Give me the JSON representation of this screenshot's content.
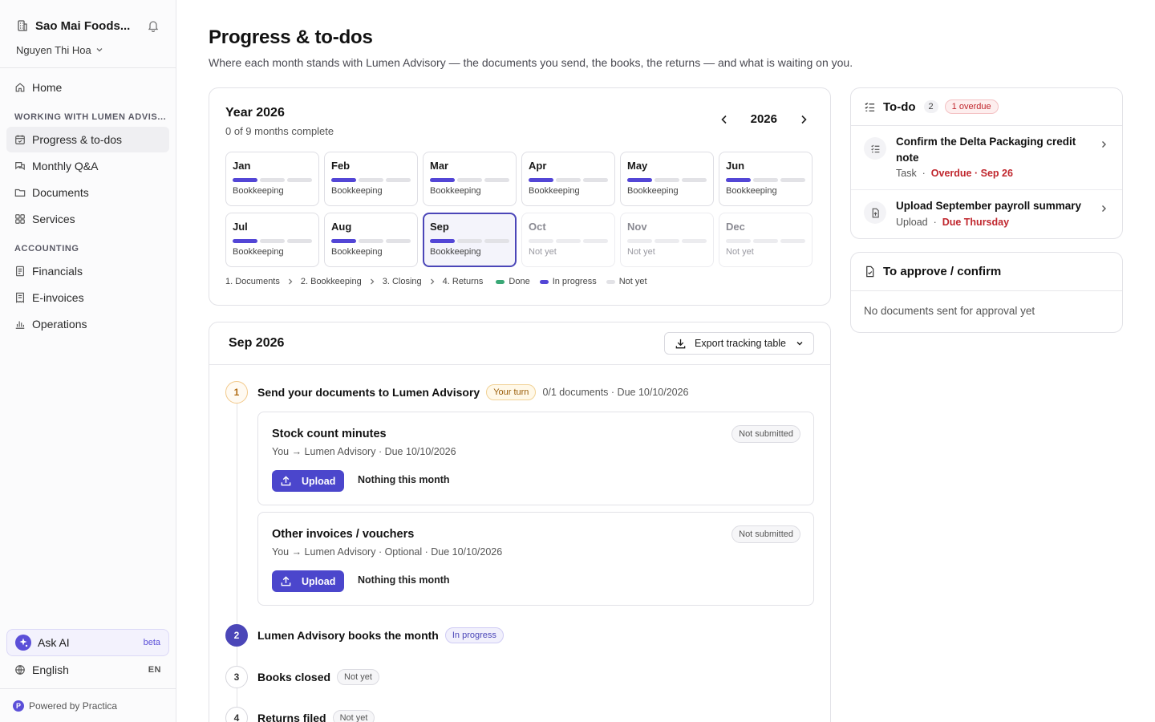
{
  "sidebar": {
    "org_name": "Sao Mai Foods...",
    "user_name": "Nguyen Thi Hoa",
    "home": "Home",
    "section_working": "WORKING WITH LUMEN ADVIS...",
    "items_working": [
      "Progress & to-dos",
      "Monthly Q&A",
      "Documents",
      "Services"
    ],
    "section_accounting": "ACCOUNTING",
    "items_accounting": [
      "Financials",
      "E-invoices",
      "Operations"
    ],
    "ask_ai": "Ask AI",
    "ask_ai_badge": "beta",
    "language": "English",
    "language_code": "EN",
    "powered_by": "Powered by Practica",
    "accent_color": "#5b4fd8"
  },
  "page": {
    "title": "Progress & to-dos",
    "subtitle": "Where each month stands with Lumen Advisory — the documents you send, the books, the returns — and what is waiting on you."
  },
  "year_card": {
    "title": "Year 2026",
    "subtitle": "0 of 9 months complete",
    "year": "2026",
    "months": [
      {
        "name": "Jan",
        "status": "Bookkeeping"
      },
      {
        "name": "Feb",
        "status": "Bookkeeping"
      },
      {
        "name": "Mar",
        "status": "Bookkeeping"
      },
      {
        "name": "Apr",
        "status": "Bookkeeping"
      },
      {
        "name": "May",
        "status": "Bookkeeping"
      },
      {
        "name": "Jun",
        "status": "Bookkeeping"
      },
      {
        "name": "Jul",
        "status": "Bookkeeping"
      },
      {
        "name": "Aug",
        "status": "Bookkeeping"
      },
      {
        "name": "Sep",
        "status": "Bookkeeping"
      },
      {
        "name": "Oct",
        "status": "Not yet"
      },
      {
        "name": "Nov",
        "status": "Not yet"
      },
      {
        "name": "Dec",
        "status": "Not yet"
      }
    ],
    "legend": {
      "stages": [
        "1. Documents",
        "2. Bookkeeping",
        "3. Closing",
        "4. Returns"
      ],
      "done": "Done",
      "in_progress": "In progress",
      "not_yet": "Not yet",
      "done_color": "#3aa876",
      "progress_color": "#5346d6",
      "not_yet_color": "#e2e2e6"
    }
  },
  "month_detail": {
    "title": "Sep 2026",
    "export_label": "Export tracking table",
    "steps": [
      {
        "num": "1",
        "title": "Send your documents to Lumen Advisory",
        "badge": "Your turn",
        "meta": "0/1 documents · Due 10/10/2026"
      },
      {
        "num": "2",
        "title": "Lumen Advisory books the month",
        "badge": "In progress"
      },
      {
        "num": "3",
        "title": "Books closed",
        "badge": "Not yet"
      },
      {
        "num": "4",
        "title": "Returns filed",
        "badge": "Not yet"
      }
    ],
    "documents": [
      {
        "title": "Stock count minutes",
        "sub": "You → Lumen Advisory   · Due 10/10/2026",
        "badge": "Not submitted",
        "upload": "Upload",
        "nothing": "Nothing this month"
      },
      {
        "title": "Other invoices / vouchers",
        "sub": "You → Lumen Advisory   · Optional   · Due 10/10/2026",
        "badge": "Not submitted",
        "upload": "Upload",
        "nothing": "Nothing this month"
      }
    ]
  },
  "todo": {
    "title": "To-do",
    "count": "2",
    "overdue_badge": "1 overdue",
    "items": [
      {
        "title": "Confirm the Delta Packaging credit note",
        "type": "Task",
        "status": "Overdue · Sep 26"
      },
      {
        "title": "Upload September payroll summary",
        "type": "Upload",
        "status": "Due Thursday"
      }
    ]
  },
  "approve": {
    "title": "To approve / confirm",
    "empty": "No documents sent for approval yet"
  }
}
